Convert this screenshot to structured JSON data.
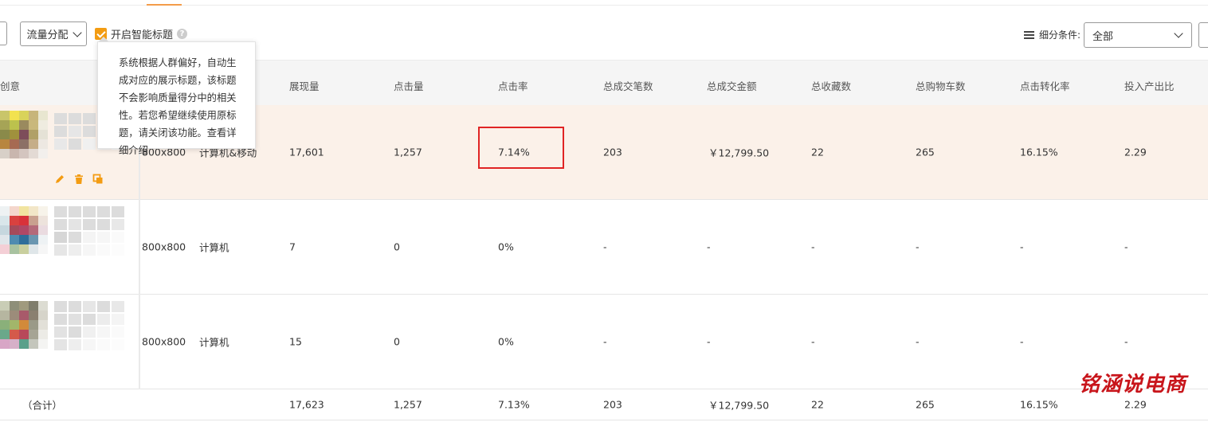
{
  "toolbar": {
    "traffic_button": "流量分配",
    "smart_title_label": "开启智能标题",
    "help_icon": "?",
    "segment_label": "细分条件:",
    "segment_value": "全部"
  },
  "tooltip": {
    "text": "系统根据人群偏好，自动生成对应的展示标题，该标题不会影响质量得分中的相关性。若您希望继续使用原标题，请关闭该功能。",
    "link": "查看详细介绍"
  },
  "table": {
    "headers": [
      "创意",
      "展现量",
      "点击量",
      "点击率",
      "总成交笔数",
      "总成交金额",
      "总收藏数",
      "总购物车数",
      "点击转化率",
      "投入产出比"
    ],
    "rows": [
      {
        "size": "800x800",
        "platform": "计算机&移动",
        "impressions": "17,601",
        "clicks": "1,257",
        "ctr": "7.14%",
        "orders": "203",
        "amount": "￥12,799.50",
        "favorites": "22",
        "carts": "265",
        "conv": "16.15%",
        "roi": "2.29"
      },
      {
        "size": "800x800",
        "platform": "计算机",
        "impressions": "7",
        "clicks": "0",
        "ctr": "0%",
        "orders": "-",
        "amount": "-",
        "favorites": "-",
        "carts": "-",
        "conv": "-",
        "roi": "-"
      },
      {
        "size": "800x800",
        "platform": "计算机",
        "impressions": "15",
        "clicks": "0",
        "ctr": "0%",
        "orders": "-",
        "amount": "-",
        "favorites": "-",
        "carts": "-",
        "conv": "-",
        "roi": "-"
      }
    ],
    "total": {
      "label": "（合计）",
      "impressions": "17,623",
      "clicks": "1,257",
      "ctr": "7.13%",
      "orders": "203",
      "amount": "￥12,799.50",
      "favorites": "22",
      "carts": "265",
      "conv": "16.15%",
      "roi": "2.29"
    }
  },
  "icons": {
    "edit": "pencil-icon",
    "delete": "trash-icon",
    "copy": "copy-icon",
    "filter": "list-icon",
    "dropdown": "chevron-down-icon"
  },
  "colors": {
    "accent": "#f39c12",
    "highlight_row": "#fbf1e9",
    "annotation_box": "#e02424",
    "watermark": "#c8151b"
  },
  "watermark": "铭涵说电商"
}
